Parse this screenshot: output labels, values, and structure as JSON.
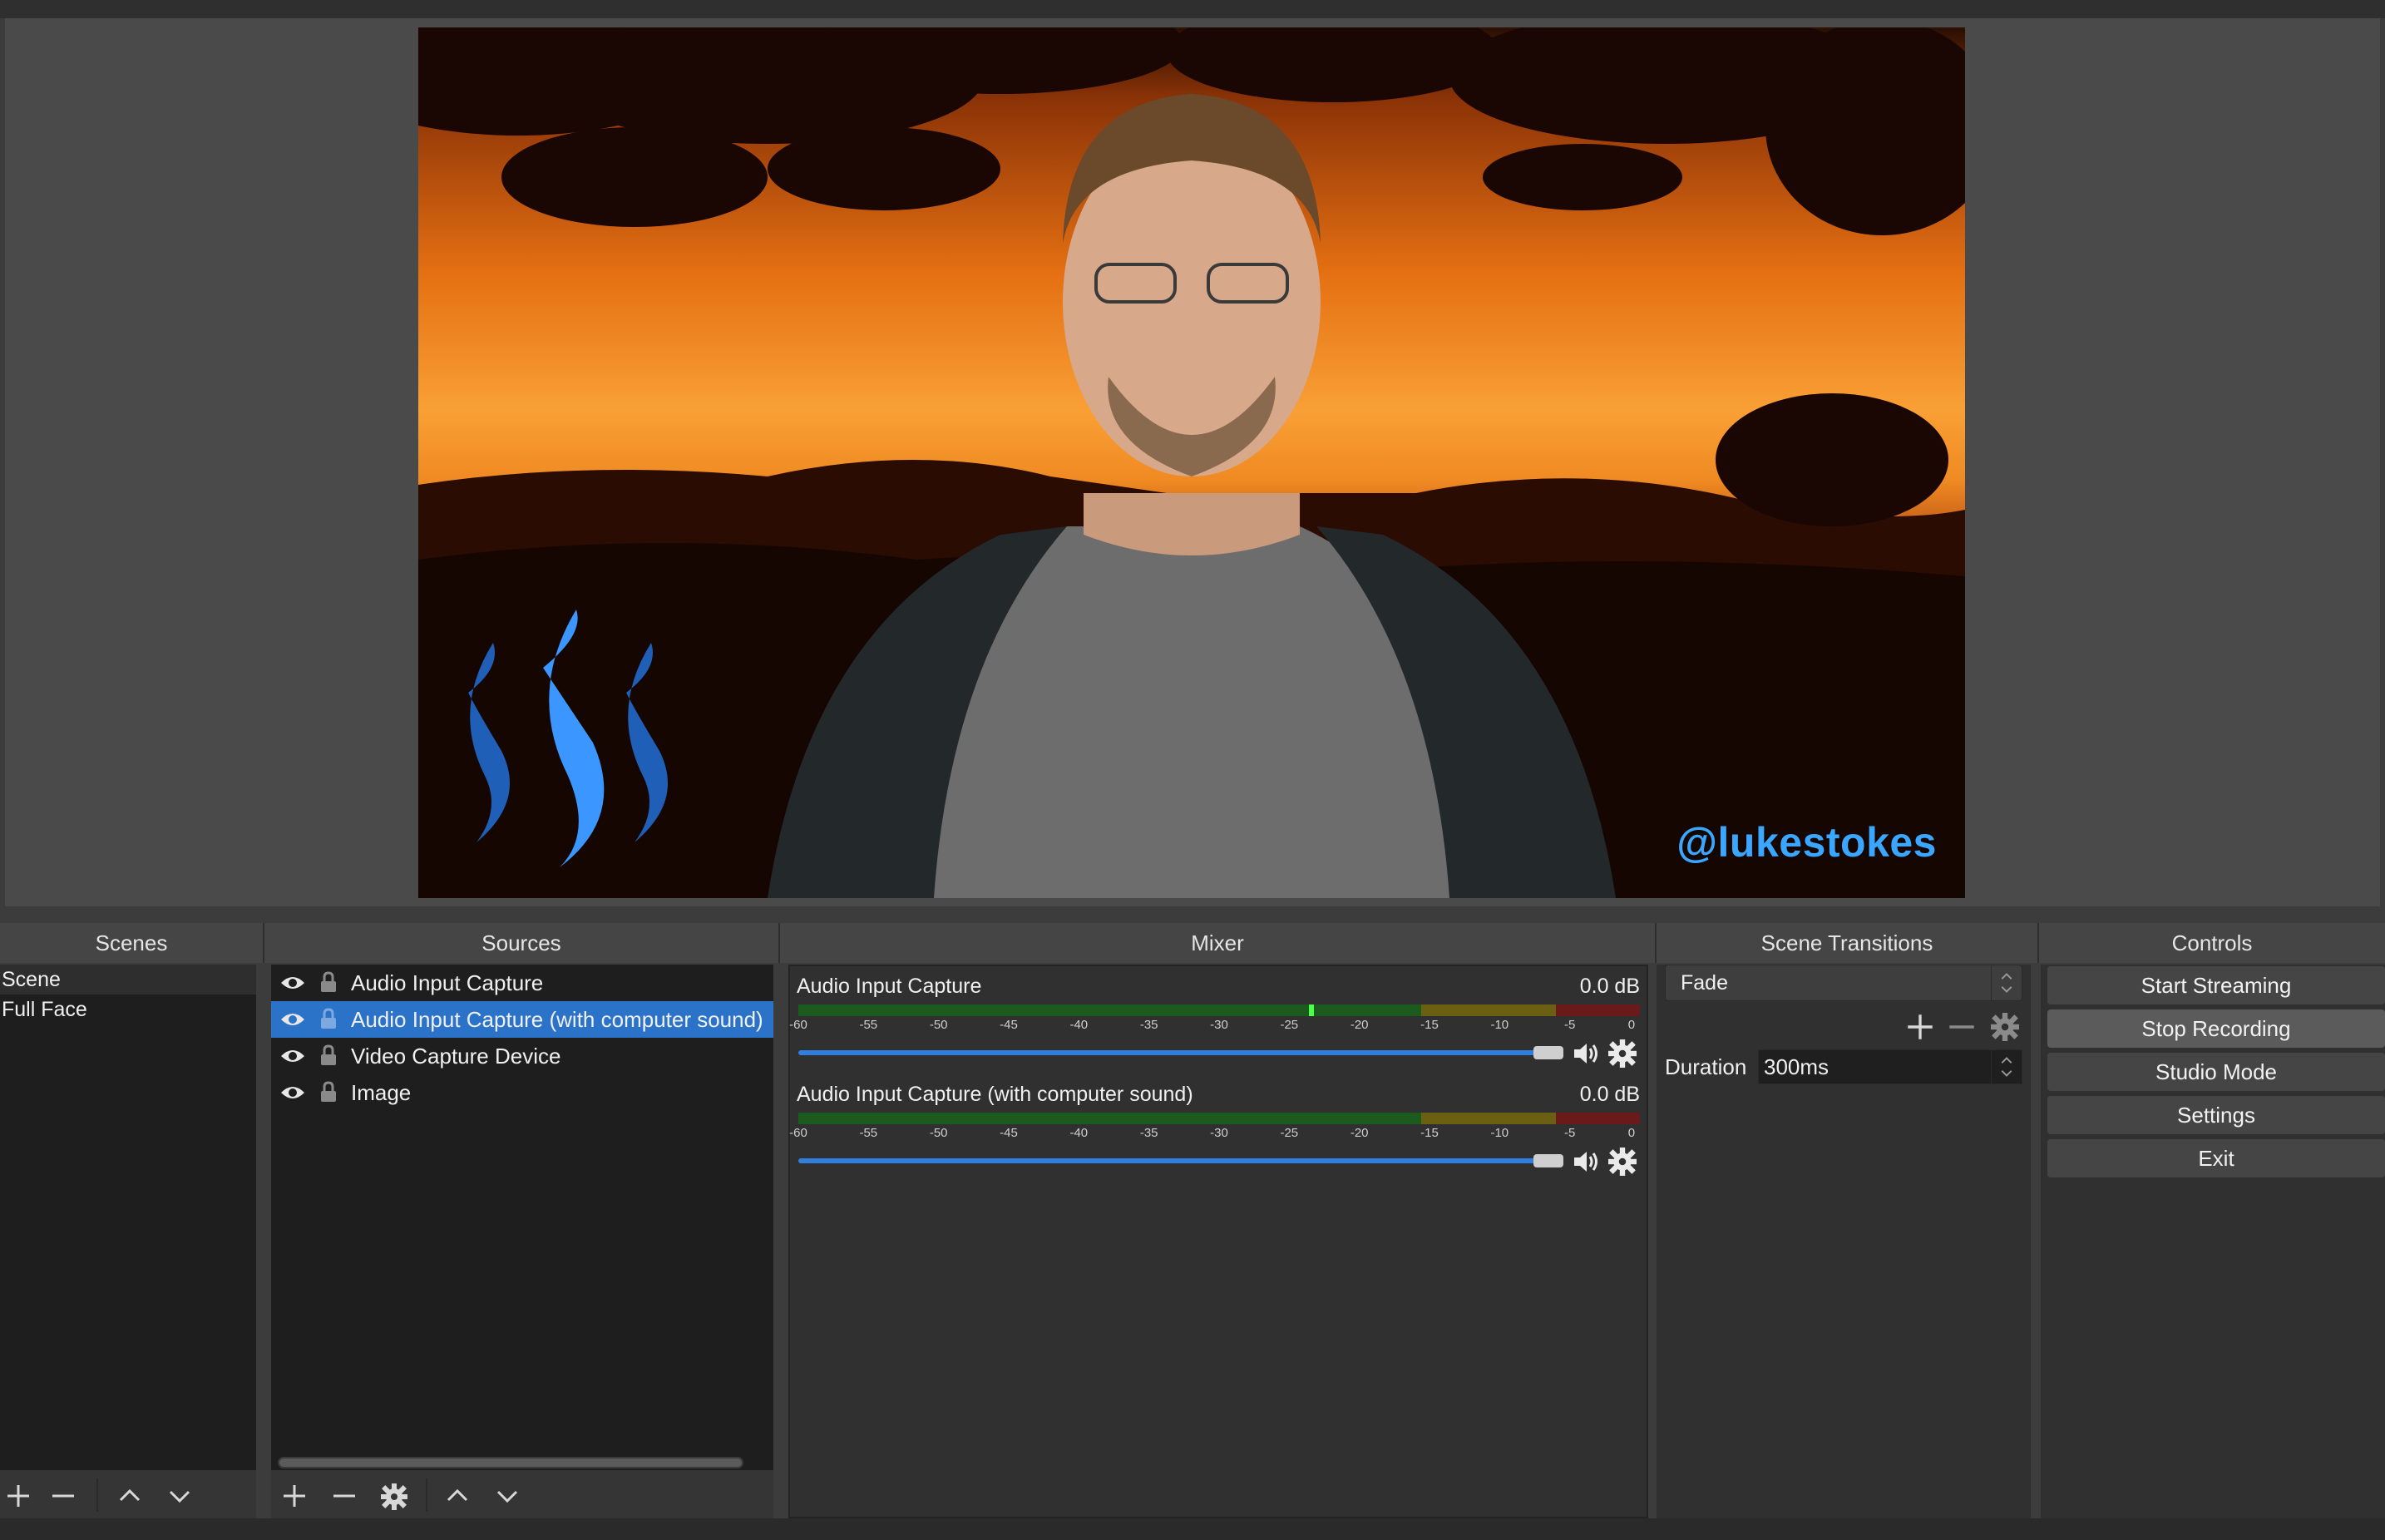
{
  "preview": {
    "watermark": "@lukestokes"
  },
  "docks": {
    "scenes_title": "Scenes",
    "sources_title": "Sources",
    "mixer_title": "Mixer",
    "transitions_title": "Scene Transitions",
    "controls_title": "Controls"
  },
  "scenes": {
    "items": [
      {
        "label": "Scene"
      },
      {
        "label": "Full Face"
      }
    ]
  },
  "sources": {
    "items": [
      {
        "label": "Audio Input Capture",
        "visible": true,
        "locked": false
      },
      {
        "label": "Audio Input Capture (with computer sound)",
        "visible": true,
        "locked": false
      },
      {
        "label": "Video Capture Device",
        "visible": true,
        "locked": false
      },
      {
        "label": "Image",
        "visible": true,
        "locked": false
      }
    ],
    "selected_index": 1
  },
  "mixer": {
    "channels": [
      {
        "name": "Audio Input Capture",
        "level": "0.0 dB",
        "volume": 1.0
      },
      {
        "name": "Audio Input Capture (with computer sound)",
        "level": "0.0 dB",
        "volume": 1.0
      }
    ],
    "scale_ticks": [
      "-60",
      "-55",
      "-50",
      "-45",
      "-40",
      "-35",
      "-30",
      "-25",
      "-20",
      "-15",
      "-10",
      "-5",
      "0"
    ]
  },
  "transitions": {
    "selected": "Fade",
    "duration_label": "Duration",
    "duration_value": "300ms"
  },
  "controls": {
    "start_streaming": "Start Streaming",
    "stop_recording": "Stop Recording",
    "studio_mode": "Studio Mode",
    "settings": "Settings",
    "exit": "Exit"
  },
  "colors": {
    "selection": "#2a73c8",
    "fader": "#2f7fe0",
    "watermark": "#3aa6ff"
  }
}
